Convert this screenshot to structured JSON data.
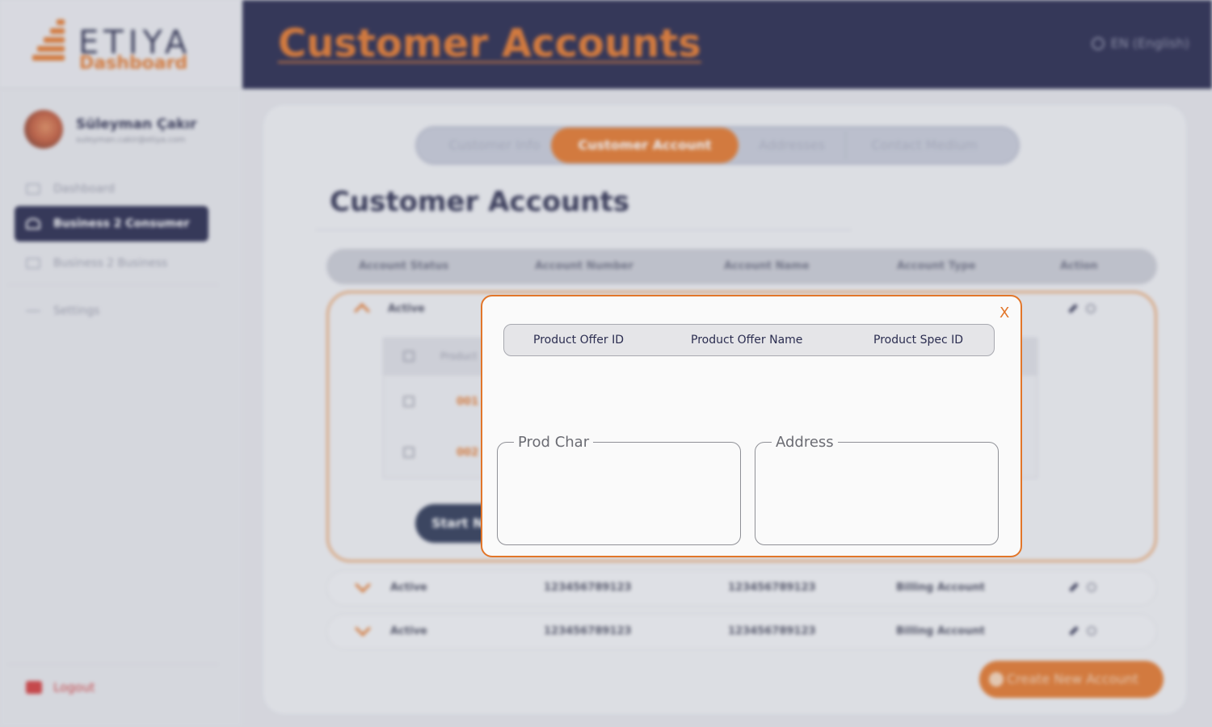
{
  "brand": {
    "name": "ETIYA",
    "subtitle": "Dashboard"
  },
  "header": {
    "title": "Customer Accounts",
    "language": "EN (English)"
  },
  "user": {
    "name": "Süleyman Çakır",
    "email": "suleyman.cakir@etiya.com"
  },
  "sidebar": {
    "items": [
      {
        "label": "Dashboard"
      },
      {
        "label": "Business 2 Consumer"
      },
      {
        "label": "Business 2 Business"
      },
      {
        "label": "Settings"
      }
    ],
    "logout": "Logout"
  },
  "tabs": [
    {
      "label": "Customer Info"
    },
    {
      "label": "Customer Account"
    },
    {
      "label": "Addresses"
    },
    {
      "label": "Contact Medium"
    }
  ],
  "section": {
    "title": "Customer Accounts"
  },
  "accounts_table": {
    "columns": [
      "Account Status",
      "Account Number",
      "Account Name",
      "Account Type",
      "Action"
    ],
    "expanded_row": {
      "status": "Active"
    },
    "inner_table": {
      "header": "Product",
      "rows": [
        {
          "id": "001"
        },
        {
          "id": "002"
        }
      ]
    },
    "start_button": "Start New",
    "rows": [
      {
        "status": "Active",
        "number": "123456789123",
        "name": "123456789123",
        "type": "Billing Account"
      },
      {
        "status": "Active",
        "number": "123456789123",
        "name": "123456789123",
        "type": "Billing Account"
      }
    ]
  },
  "create_button": "Create New Account",
  "modal": {
    "close_label": "X",
    "columns": [
      "Product Offer ID",
      "Product Offer Name",
      "Product Spec ID"
    ],
    "prod_char_label": "Prod Char",
    "address_label": "Address"
  },
  "colors": {
    "accent": "#e2762a",
    "navy": "#23254a"
  }
}
